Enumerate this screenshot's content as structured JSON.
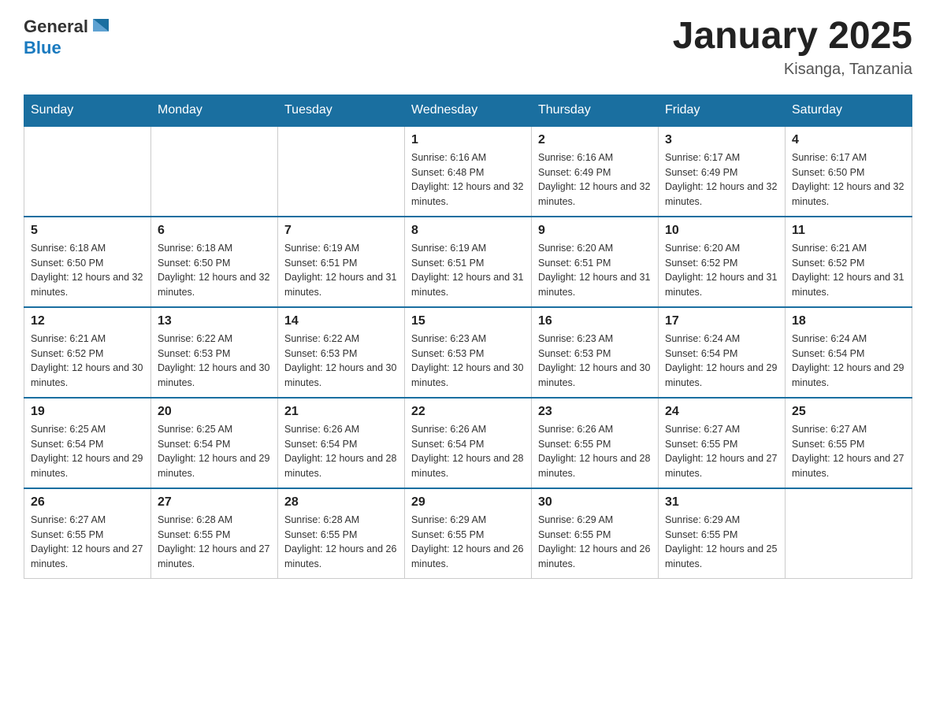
{
  "header": {
    "logo": {
      "text_general": "General",
      "text_blue": "Blue",
      "alt": "GeneralBlue logo"
    },
    "title": "January 2025",
    "subtitle": "Kisanga, Tanzania"
  },
  "calendar": {
    "days_of_week": [
      "Sunday",
      "Monday",
      "Tuesday",
      "Wednesday",
      "Thursday",
      "Friday",
      "Saturday"
    ],
    "weeks": [
      [
        {
          "day": "",
          "info": ""
        },
        {
          "day": "",
          "info": ""
        },
        {
          "day": "",
          "info": ""
        },
        {
          "day": "1",
          "info": "Sunrise: 6:16 AM\nSunset: 6:48 PM\nDaylight: 12 hours and 32 minutes."
        },
        {
          "day": "2",
          "info": "Sunrise: 6:16 AM\nSunset: 6:49 PM\nDaylight: 12 hours and 32 minutes."
        },
        {
          "day": "3",
          "info": "Sunrise: 6:17 AM\nSunset: 6:49 PM\nDaylight: 12 hours and 32 minutes."
        },
        {
          "day": "4",
          "info": "Sunrise: 6:17 AM\nSunset: 6:50 PM\nDaylight: 12 hours and 32 minutes."
        }
      ],
      [
        {
          "day": "5",
          "info": "Sunrise: 6:18 AM\nSunset: 6:50 PM\nDaylight: 12 hours and 32 minutes."
        },
        {
          "day": "6",
          "info": "Sunrise: 6:18 AM\nSunset: 6:50 PM\nDaylight: 12 hours and 32 minutes."
        },
        {
          "day": "7",
          "info": "Sunrise: 6:19 AM\nSunset: 6:51 PM\nDaylight: 12 hours and 31 minutes."
        },
        {
          "day": "8",
          "info": "Sunrise: 6:19 AM\nSunset: 6:51 PM\nDaylight: 12 hours and 31 minutes."
        },
        {
          "day": "9",
          "info": "Sunrise: 6:20 AM\nSunset: 6:51 PM\nDaylight: 12 hours and 31 minutes."
        },
        {
          "day": "10",
          "info": "Sunrise: 6:20 AM\nSunset: 6:52 PM\nDaylight: 12 hours and 31 minutes."
        },
        {
          "day": "11",
          "info": "Sunrise: 6:21 AM\nSunset: 6:52 PM\nDaylight: 12 hours and 31 minutes."
        }
      ],
      [
        {
          "day": "12",
          "info": "Sunrise: 6:21 AM\nSunset: 6:52 PM\nDaylight: 12 hours and 30 minutes."
        },
        {
          "day": "13",
          "info": "Sunrise: 6:22 AM\nSunset: 6:53 PM\nDaylight: 12 hours and 30 minutes."
        },
        {
          "day": "14",
          "info": "Sunrise: 6:22 AM\nSunset: 6:53 PM\nDaylight: 12 hours and 30 minutes."
        },
        {
          "day": "15",
          "info": "Sunrise: 6:23 AM\nSunset: 6:53 PM\nDaylight: 12 hours and 30 minutes."
        },
        {
          "day": "16",
          "info": "Sunrise: 6:23 AM\nSunset: 6:53 PM\nDaylight: 12 hours and 30 minutes."
        },
        {
          "day": "17",
          "info": "Sunrise: 6:24 AM\nSunset: 6:54 PM\nDaylight: 12 hours and 29 minutes."
        },
        {
          "day": "18",
          "info": "Sunrise: 6:24 AM\nSunset: 6:54 PM\nDaylight: 12 hours and 29 minutes."
        }
      ],
      [
        {
          "day": "19",
          "info": "Sunrise: 6:25 AM\nSunset: 6:54 PM\nDaylight: 12 hours and 29 minutes."
        },
        {
          "day": "20",
          "info": "Sunrise: 6:25 AM\nSunset: 6:54 PM\nDaylight: 12 hours and 29 minutes."
        },
        {
          "day": "21",
          "info": "Sunrise: 6:26 AM\nSunset: 6:54 PM\nDaylight: 12 hours and 28 minutes."
        },
        {
          "day": "22",
          "info": "Sunrise: 6:26 AM\nSunset: 6:54 PM\nDaylight: 12 hours and 28 minutes."
        },
        {
          "day": "23",
          "info": "Sunrise: 6:26 AM\nSunset: 6:55 PM\nDaylight: 12 hours and 28 minutes."
        },
        {
          "day": "24",
          "info": "Sunrise: 6:27 AM\nSunset: 6:55 PM\nDaylight: 12 hours and 27 minutes."
        },
        {
          "day": "25",
          "info": "Sunrise: 6:27 AM\nSunset: 6:55 PM\nDaylight: 12 hours and 27 minutes."
        }
      ],
      [
        {
          "day": "26",
          "info": "Sunrise: 6:27 AM\nSunset: 6:55 PM\nDaylight: 12 hours and 27 minutes."
        },
        {
          "day": "27",
          "info": "Sunrise: 6:28 AM\nSunset: 6:55 PM\nDaylight: 12 hours and 27 minutes."
        },
        {
          "day": "28",
          "info": "Sunrise: 6:28 AM\nSunset: 6:55 PM\nDaylight: 12 hours and 26 minutes."
        },
        {
          "day": "29",
          "info": "Sunrise: 6:29 AM\nSunset: 6:55 PM\nDaylight: 12 hours and 26 minutes."
        },
        {
          "day": "30",
          "info": "Sunrise: 6:29 AM\nSunset: 6:55 PM\nDaylight: 12 hours and 26 minutes."
        },
        {
          "day": "31",
          "info": "Sunrise: 6:29 AM\nSunset: 6:55 PM\nDaylight: 12 hours and 25 minutes."
        },
        {
          "day": "",
          "info": ""
        }
      ]
    ]
  }
}
